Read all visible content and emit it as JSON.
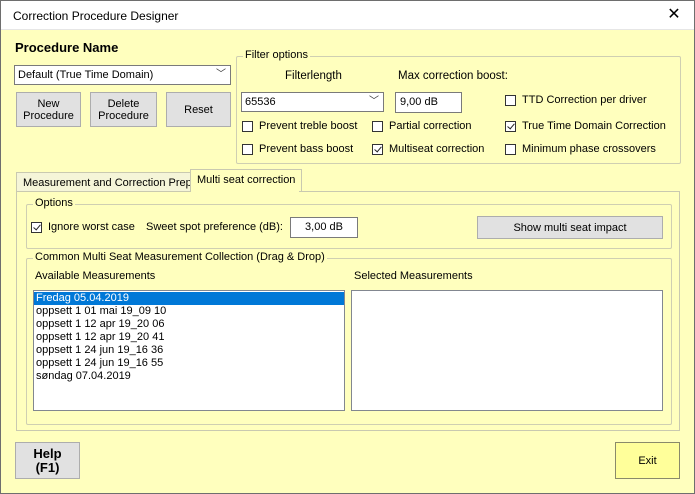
{
  "window": {
    "title": "Correction Procedure Designer",
    "close_glyph": "✕"
  },
  "procedure": {
    "heading": "Procedure Name",
    "selected": "Default (True Time Domain)",
    "new_label": "New\nProcedure",
    "delete_label": "Delete\nProcedure",
    "reset_label": "Reset"
  },
  "filter": {
    "legend": "Filter options",
    "filterlength_label": "Filterlength",
    "filterlength_value": "65536",
    "maxboost_label": "Max correction boost:",
    "maxboost_value": "9,00 dB",
    "ttd_per_driver": {
      "label": "TTD Correction per driver",
      "checked": false
    },
    "prevent_treble": {
      "label": "Prevent treble boost",
      "checked": false
    },
    "partial": {
      "label": "Partial correction",
      "checked": false
    },
    "true_time": {
      "label": "True Time Domain Correction",
      "checked": true
    },
    "prevent_bass": {
      "label": "Prevent bass boost",
      "checked": false
    },
    "multiseat": {
      "label": "Multiseat correction",
      "checked": true
    },
    "min_phase": {
      "label": "Minimum phase crossovers",
      "checked": false
    }
  },
  "tabs": [
    {
      "label": "Measurement and Correction Prep",
      "active": false
    },
    {
      "label": "Multi seat correction",
      "active": true
    }
  ],
  "options": {
    "legend": "Options",
    "ignore_worst": {
      "label": "Ignore worst case",
      "checked": true
    },
    "sweetspot_label": "Sweet spot preference (dB):",
    "sweetspot_value": "3,00 dB",
    "show_impact_label": "Show multi seat impact"
  },
  "collection": {
    "legend": "Common Multi Seat Measurement Collection  (Drag & Drop)",
    "available_label": "Available Measurements",
    "selected_label": "Selected Measurements",
    "available_items": [
      "Fredag 05.04.2019",
      "oppsett 1 01 mai 19_09 10",
      "oppsett 1 12 apr 19_20 06",
      "oppsett 1 12 apr 19_20 41",
      "oppsett 1 24 jun 19_16 36",
      "oppsett 1 24 jun 19_16 55",
      "søndag 07.04.2019"
    ],
    "selected_index": 0,
    "selected_items": []
  },
  "footer": {
    "help_label": "Help\n(F1)",
    "exit_label": "Exit"
  },
  "colors": {
    "background": "#ffffbe",
    "selection": "#0078d7",
    "exit_button": "#ffff9a"
  }
}
